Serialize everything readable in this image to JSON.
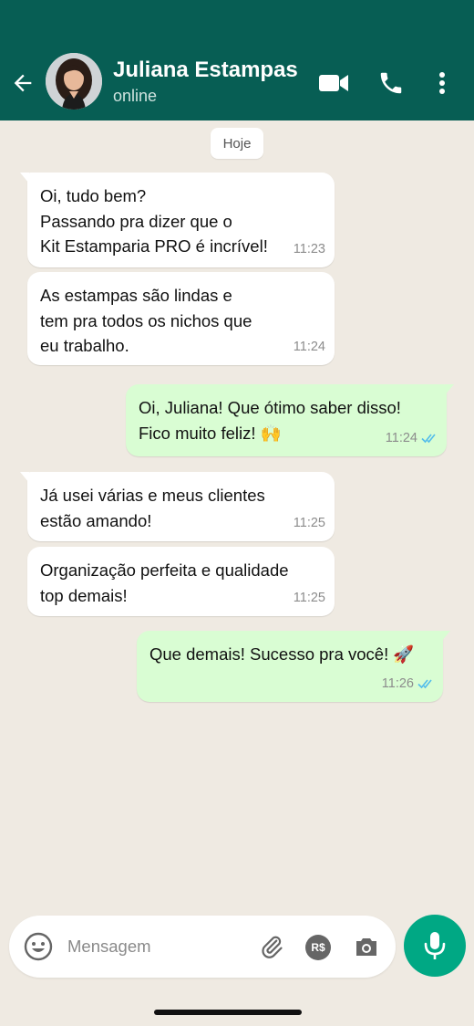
{
  "header": {
    "contact_name": "Juliana Estampas",
    "status": "online",
    "bg_color": "#075e54"
  },
  "chat": {
    "date_label": "Hoje",
    "messages": [
      {
        "direction": "in",
        "text": "Oi, tudo bem?\nPassando pra dizer que o\nKit Estamparia PRO é incrível!",
        "time": "11:23"
      },
      {
        "direction": "in",
        "text": "As estampas são lindas e\ntem pra todos os nichos que\neu trabalho.",
        "time": "11:24"
      },
      {
        "direction": "out",
        "text": "Oi, Juliana! Que ótimo saber disso!\nFico muito feliz! 🙌",
        "time": "11:24",
        "status": "read"
      },
      {
        "direction": "in",
        "text": "Já usei várias e meus clientes\nestão amando!",
        "time": "11:25"
      },
      {
        "direction": "in",
        "text": "Organização perfeita e qualidade\ntop demais!",
        "time": "11:25"
      },
      {
        "direction": "out",
        "text": "Que demais! Sucesso pra você! 🚀",
        "time": "11:26",
        "status": "read"
      }
    ]
  },
  "composer": {
    "placeholder": "Mensagem",
    "pay_label": "R$"
  },
  "colors": {
    "accent": "#00a884",
    "outgoing_bubble": "#d9fdd3",
    "read_ticks": "#53bdeb"
  }
}
